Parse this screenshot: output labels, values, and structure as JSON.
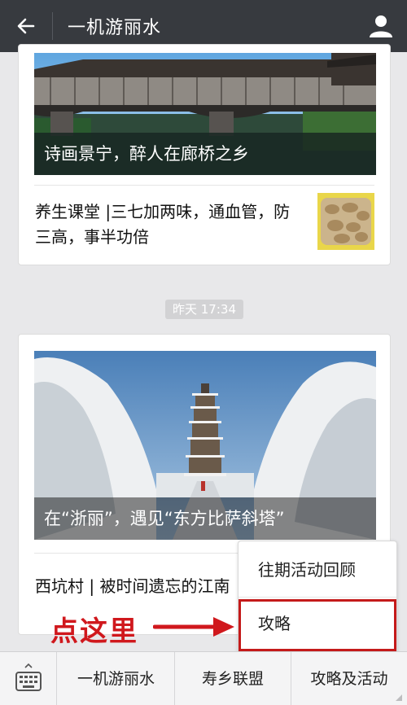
{
  "header": {
    "back_icon": "back-arrow-icon",
    "title": "一机游丽水",
    "profile_icon": "user-profile-icon"
  },
  "feed": {
    "group1": {
      "cover_caption": "诗画景宁，醉人在廊桥之乡",
      "sub_article_title": "养生课堂 |三七加两味，通血管，防三高，事半功倍"
    },
    "timestamp": "昨天 17:34",
    "group2": {
      "cover_caption": "在“浙丽”，遇见“东方比萨斜塔”",
      "sub_article_title": "西坑村 | 被时间遗忘的江南"
    }
  },
  "popup_menu": {
    "items": [
      "往期活动回顾",
      "攻略"
    ]
  },
  "annotation": {
    "label": "点这里",
    "color": "#d0181d"
  },
  "bottom_menu": {
    "keyboard_icon": "keyboard-icon",
    "items": [
      "一机游丽水",
      "寿乡联盟",
      "攻略及活动"
    ]
  },
  "colors": {
    "header_bg": "#373a3f",
    "page_bg": "#e8e8ea",
    "highlight_border": "#c41a1a"
  }
}
